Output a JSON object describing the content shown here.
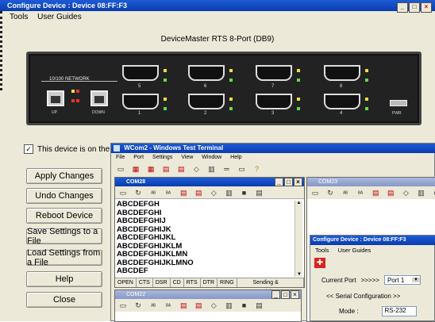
{
  "main_window": {
    "title": "Configure Device : Device 08:FF:F3",
    "menu": [
      "Tools",
      "User Guides"
    ],
    "device_label": "DeviceMaster RTS 8-Port (DB9)",
    "network_label": "10/100 NETWORK",
    "up_label": "UP",
    "down_label": "DOWN",
    "pwr_label": "PWR",
    "top_ports": [
      "5",
      "6",
      "7",
      "8"
    ],
    "bottom_ports": [
      "1",
      "2",
      "3",
      "4"
    ],
    "checkbox_label": "This device is on the local",
    "buttons": [
      "Apply Changes",
      "Undo Changes",
      "Reboot Device",
      "Save Settings to a File",
      "Load Settings from a File",
      "Help",
      "Close"
    ]
  },
  "wcom": {
    "title": "WCom2 - Windows Test Terminal",
    "menu": [
      "File",
      "Port",
      "Settings",
      "View",
      "Window",
      "Help"
    ],
    "com28": {
      "title": "COM28",
      "lines": [
        "ABCDEFGH",
        "ABCDEFGHI",
        "ABCDEFGHIJ",
        "ABCDEFGHIJK",
        "ABCDEFGHIJKL",
        "ABCDEFGHIJKLM",
        "ABCDEFGHIJKLMN",
        "ABCDEFGHIJKLMNO",
        "ABCDEF"
      ],
      "status": [
        "OPEN",
        "CTS",
        "DSR",
        "CD",
        "RTS",
        "DTR",
        "RING",
        "Sending & Receiving..."
      ]
    },
    "com22": {
      "title": "COM22"
    },
    "com23": {
      "title": "COM23"
    }
  },
  "small_config": {
    "title": "Configure Device : Device 08:FF:F3",
    "menu": [
      "Tools",
      "User Guides"
    ],
    "current_port_label": "Current Port",
    "arrows": ">>>>>",
    "current_port_value": "Port 1",
    "serial_config_label": "<< Serial Configuration >>",
    "mode_label": "Mode :",
    "mode_value": "RS-232"
  }
}
